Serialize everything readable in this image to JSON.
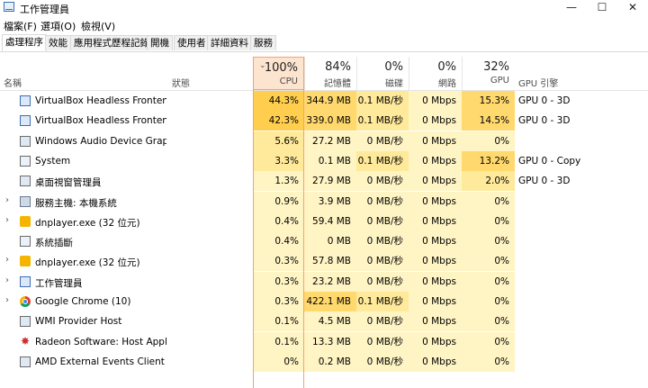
{
  "window": {
    "title": "工作管理員",
    "minimize": "—",
    "maximize": "☐",
    "close": "✕"
  },
  "menu": [
    "檔案(F)",
    "選項(O)",
    "檢視(V)"
  ],
  "tabs": [
    "處理程序",
    "效能",
    "應用程式歷程記錄",
    "開機",
    "使用者",
    "詳細資料",
    "服務"
  ],
  "header": {
    "name": "名稱",
    "status": "狀態",
    "cpu_pct": "100%",
    "cpu": "CPU",
    "mem_pct": "84%",
    "mem": "記憶體",
    "disk_pct": "0%",
    "disk": "磁碟",
    "net_pct": "0%",
    "net": "網路",
    "gpu_pct": "32%",
    "gpu": "GPU",
    "gpu_engine": "GPU 引擎"
  },
  "rows": [
    {
      "name": "VirtualBox Headless Frontend",
      "icon": "vbox-icon",
      "expand": false,
      "cpu": "44.3%",
      "mem": "344.9 MB",
      "disk": "0.1 MB/秒",
      "net": "0 Mbps",
      "gpu": "15.3%",
      "engine": "GPU 0 - 3D"
    },
    {
      "name": "VirtualBox Headless Frontend",
      "icon": "vbox-icon",
      "expand": false,
      "cpu": "42.3%",
      "mem": "339.0 MB",
      "disk": "0.1 MB/秒",
      "net": "0 Mbps",
      "gpu": "14.5%",
      "engine": "GPU 0 - 3D"
    },
    {
      "name": "Windows Audio Device Graph...",
      "icon": "window-icon",
      "expand": false,
      "cpu": "5.6%",
      "mem": "27.2 MB",
      "disk": "0 MB/秒",
      "net": "0 Mbps",
      "gpu": "0%",
      "engine": ""
    },
    {
      "name": "System",
      "icon": "system-icon",
      "expand": false,
      "cpu": "3.3%",
      "mem": "0.1 MB",
      "disk": "0.1 MB/秒",
      "net": "0 Mbps",
      "gpu": "13.2%",
      "engine": "GPU 0 - Copy"
    },
    {
      "name": "桌面視窗管理員",
      "icon": "window-icon",
      "expand": false,
      "cpu": "1.3%",
      "mem": "27.9 MB",
      "disk": "0 MB/秒",
      "net": "0 Mbps",
      "gpu": "2.0%",
      "engine": "GPU 0 - 3D"
    },
    {
      "name": "服務主機: 本機系統",
      "icon": "gear-icon",
      "expand": true,
      "cpu": "0.9%",
      "mem": "3.9 MB",
      "disk": "0 MB/秒",
      "net": "0 Mbps",
      "gpu": "0%",
      "engine": ""
    },
    {
      "name": "dnplayer.exe (32 位元)",
      "icon": "dnplayer-icon",
      "expand": true,
      "cpu": "0.4%",
      "mem": "59.4 MB",
      "disk": "0 MB/秒",
      "net": "0 Mbps",
      "gpu": "0%",
      "engine": ""
    },
    {
      "name": "系統插斷",
      "icon": "system-icon",
      "expand": false,
      "cpu": "0.4%",
      "mem": "0 MB",
      "disk": "0 MB/秒",
      "net": "0 Mbps",
      "gpu": "0%",
      "engine": ""
    },
    {
      "name": "dnplayer.exe (32 位元)",
      "icon": "dnplayer-icon",
      "expand": true,
      "cpu": "0.3%",
      "mem": "57.8 MB",
      "disk": "0 MB/秒",
      "net": "0 Mbps",
      "gpu": "0%",
      "engine": ""
    },
    {
      "name": "工作管理員",
      "icon": "taskmgr-icon",
      "expand": true,
      "cpu": "0.3%",
      "mem": "23.2 MB",
      "disk": "0 MB/秒",
      "net": "0 Mbps",
      "gpu": "0%",
      "engine": ""
    },
    {
      "name": "Google Chrome (10)",
      "icon": "chrome-icon",
      "expand": true,
      "cpu": "0.3%",
      "mem": "422.1 MB",
      "disk": "0.1 MB/秒",
      "net": "0 Mbps",
      "gpu": "0%",
      "engine": ""
    },
    {
      "name": "WMI Provider Host",
      "icon": "window-icon",
      "expand": false,
      "cpu": "0.1%",
      "mem": "4.5 MB",
      "disk": "0 MB/秒",
      "net": "0 Mbps",
      "gpu": "0%",
      "engine": ""
    },
    {
      "name": "Radeon Software: Host Applic...",
      "icon": "radeon-icon",
      "expand": false,
      "cpu": "0.1%",
      "mem": "13.3 MB",
      "disk": "0 MB/秒",
      "net": "0 Mbps",
      "gpu": "0%",
      "engine": ""
    },
    {
      "name": "AMD External Events Client M...",
      "icon": "window-icon",
      "expand": false,
      "cpu": "0%",
      "mem": "0.2 MB",
      "disk": "0 MB/秒",
      "net": "0 Mbps",
      "gpu": "0%",
      "engine": ""
    }
  ]
}
